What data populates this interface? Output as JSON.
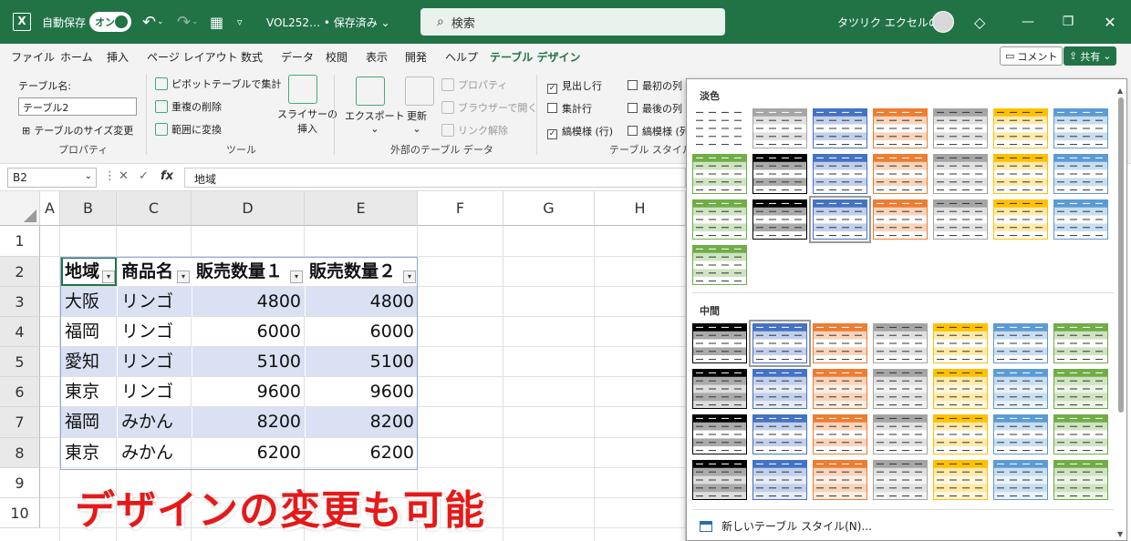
{
  "titlebar": {
    "logo": "X",
    "autosave_label": "自動保存",
    "autosave_state": "オン",
    "doc_title": "VOL252…  • 保存済み ⌄",
    "search_placeholder": "検索",
    "user_name": "タツリク エクセルの森",
    "icons": [
      "excel-logo-icon",
      "undo-icon",
      "redo-icon",
      "table-icon",
      "customize-icon",
      "search-icon",
      "avatar",
      "diamond-icon",
      "minimize-icon",
      "restore-icon",
      "close-icon"
    ]
  },
  "tabs": [
    "ファイル",
    "ホーム",
    "挿入",
    "ページ レイアウト",
    "数式",
    "データ",
    "校閲",
    "表示",
    "開発",
    "ヘルプ",
    "テーブル デザイン"
  ],
  "active_tab": "テーブル デザイン",
  "header_buttons": {
    "comment": "コメント",
    "share": "共有"
  },
  "ribbon": {
    "table_name_label": "テーブル名:",
    "table_name_value": "テーブル2",
    "resize_label": "テーブルのサイズ変更",
    "group_properties": "プロパティ",
    "pivot_label": "ピボットテーブルで集計",
    "remove_dup_label": "重複の削除",
    "convert_label": "範囲に変換",
    "slicer_label_1": "スライサーの",
    "slicer_label_2": "挿入",
    "group_tools": "ツール",
    "export_label": "エクスポート",
    "refresh_label": "更新",
    "properties_label": "プロパティ",
    "browser_label": "ブラウザーで開く",
    "unlink_label": "リンク解除",
    "group_external": "外部のテーブル データ",
    "header_row": "見出し行",
    "total_row": "集計行",
    "banded_rows": "縞模様 (行)",
    "first_col": "最初の列",
    "last_col": "最後の列",
    "banded_cols": "縞模様 (列)",
    "group_style_options": "テーブル スタイルのオプション"
  },
  "formula_bar": {
    "name_box": "B2",
    "fx": "fx",
    "value": "地域"
  },
  "sheet": {
    "columns": [
      "A",
      "B",
      "C",
      "D",
      "E",
      "F",
      "G",
      "H"
    ],
    "rows": [
      "1",
      "2",
      "3",
      "4",
      "5",
      "6",
      "7",
      "8",
      "9",
      "10"
    ],
    "headers": [
      "地域",
      "商品名",
      "販売数量１",
      "販売数量２"
    ],
    "data": [
      [
        "大阪",
        "リンゴ",
        "4800",
        "4800"
      ],
      [
        "福岡",
        "リンゴ",
        "6000",
        "6000"
      ],
      [
        "愛知",
        "リンゴ",
        "5100",
        "5100"
      ],
      [
        "東京",
        "リンゴ",
        "9600",
        "9600"
      ],
      [
        "福岡",
        "みかん",
        "8200",
        "8200"
      ],
      [
        "東京",
        "みかん",
        "6200",
        "6200"
      ]
    ],
    "band_color": "#d9e1f2",
    "border_color": "#8ea9db"
  },
  "caption": "デザインの変更も可能",
  "gallery": {
    "section_light": "淡色",
    "section_medium": "中間",
    "new_style": "新しいテーブル スタイル(N)...",
    "palette": [
      "#a6a6a6",
      "#000000",
      "#4472c4",
      "#ed7d31",
      "#a5a5a5",
      "#ffc000",
      "#5b9bd5",
      "#70ad47"
    ]
  }
}
